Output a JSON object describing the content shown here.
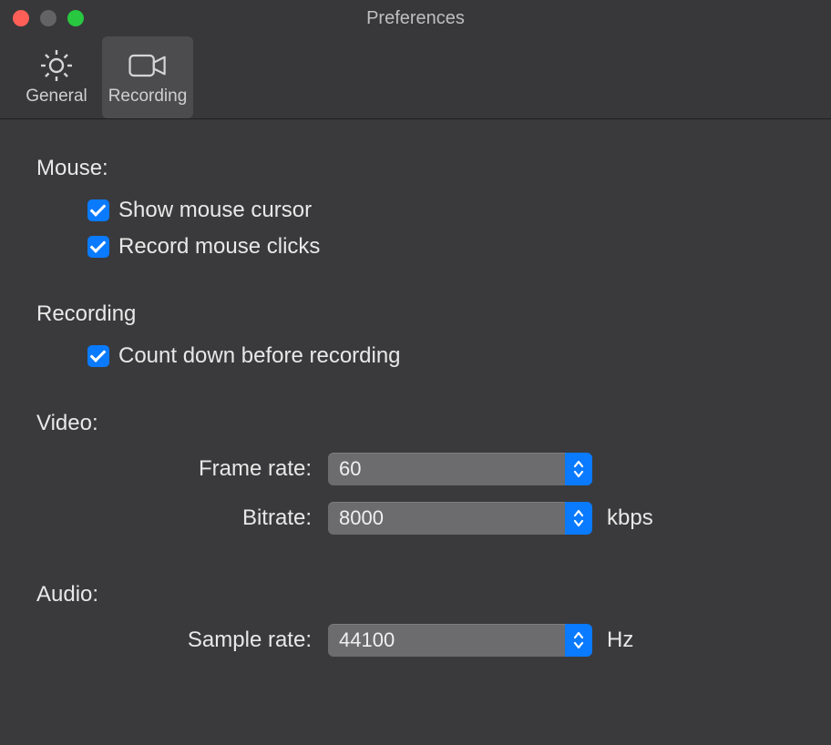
{
  "window": {
    "title": "Preferences"
  },
  "tabs": {
    "general": "General",
    "recording": "Recording"
  },
  "sections": {
    "mouse": {
      "title": "Mouse:",
      "show_cursor": "Show mouse cursor",
      "record_clicks": "Record mouse clicks"
    },
    "recording": {
      "title": "Recording",
      "countdown": "Count down before recording"
    },
    "video": {
      "title": "Video:",
      "frame_rate_label": "Frame rate:",
      "frame_rate_value": "60",
      "bitrate_label": "Bitrate:",
      "bitrate_value": "8000",
      "bitrate_unit": "kbps"
    },
    "audio": {
      "title": "Audio:",
      "sample_rate_label": "Sample rate:",
      "sample_rate_value": "44100",
      "sample_rate_unit": "Hz"
    }
  }
}
